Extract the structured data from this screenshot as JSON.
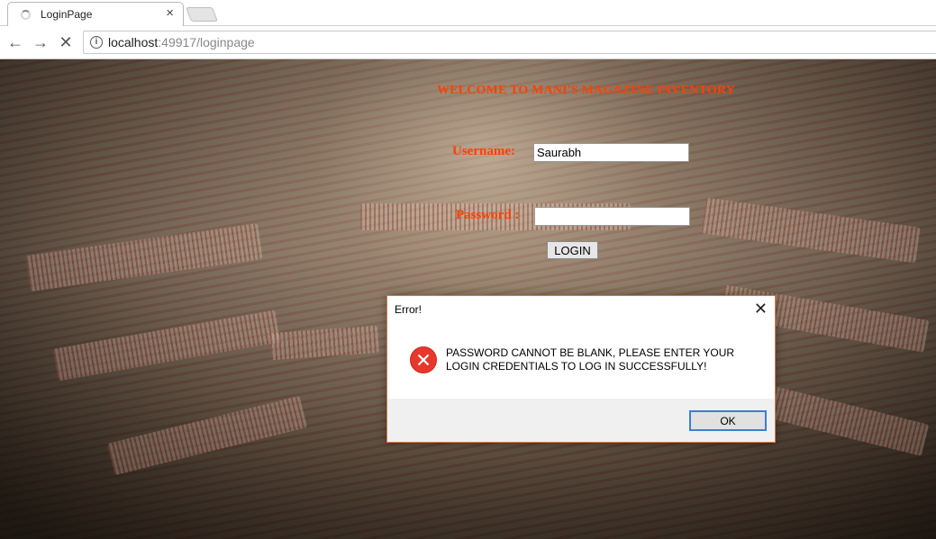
{
  "browser": {
    "tab_title": "LoginPage",
    "url_host": "localhost",
    "url_rest": ":49917/loginpage"
  },
  "page": {
    "welcome": "WELCOME TO MANI'S MAGAZINE INVENTORY",
    "username_label": "Username:",
    "username_value": "Saurabh",
    "password_label": "Password :",
    "password_value": "",
    "login_button": "LOGIN",
    "accent_color": "#ff4000"
  },
  "dialog": {
    "title": "Error!",
    "message": "PASSWORD CANNOT BE BLANK, PLEASE ENTER YOUR LOGIN CREDENTIALS TO LOG IN SUCCESSFULLY!",
    "ok_button": "OK",
    "icon": "error-icon"
  }
}
